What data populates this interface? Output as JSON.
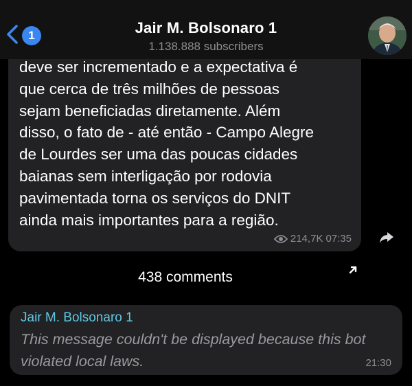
{
  "header": {
    "back_badge": "1",
    "title": "Jair M. Bolsonaro 1",
    "subtitle": "1.138.888 subscribers"
  },
  "post": {
    "text": "deve ser incrementado e a expectativa é\nque cerca de três milhões de pessoas\nsejam beneficiadas diretamente. Além\ndisso, o fato de - até então - Campo Alegre\nde Lourdes ser uma das poucas cidades\nbaianas sem interligação por rodovia\npavimentada torna os serviços do DNIT\nainda mais importantes para a região.",
    "views": "214,7K",
    "time": "07:35"
  },
  "comments": {
    "label": "438 comments"
  },
  "comment": {
    "author": "Jair M. Bolsonaro 1",
    "text": "This message couldn't be displayed because this bot violated local laws.",
    "time": "21:30"
  },
  "colors": {
    "accent": "#3a87f2",
    "author": "#5ec9e4",
    "bubble": "#222224",
    "background": "#000000"
  },
  "icons": {
    "back": "chevron-left-icon",
    "views": "eye-icon",
    "forward": "share-forward-icon",
    "comments": "arrow-up-right-icon"
  }
}
